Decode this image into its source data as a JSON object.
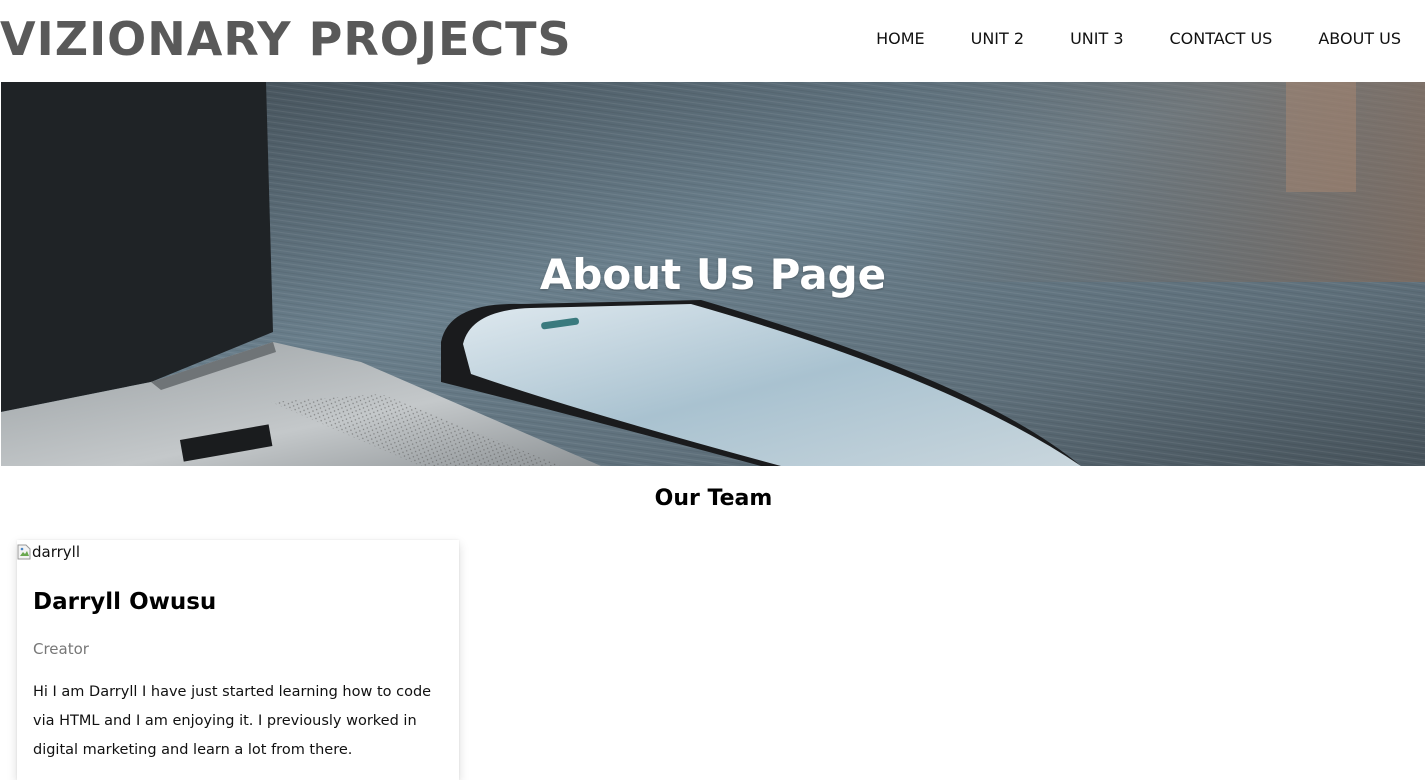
{
  "header": {
    "logo": "VIZIONARY PROJECTS",
    "nav": [
      {
        "label": "HOME"
      },
      {
        "label": "UNIT 2"
      },
      {
        "label": "UNIT 3"
      },
      {
        "label": "CONTACT US"
      },
      {
        "label": "ABOUT US"
      }
    ]
  },
  "hero": {
    "title": "About Us Page"
  },
  "team": {
    "heading": "Our Team",
    "members": [
      {
        "image_alt": "darryll",
        "name": "Darryll Owusu",
        "role": "Creator",
        "bio": "Hi I am Darryll I have just started learning how to code via HTML and I am enjoying it. I previously worked in digital marketing and learn a lot from there."
      }
    ]
  },
  "colors": {
    "logo": "#595959",
    "nav_text": "#111111",
    "hero_title": "#ffffff",
    "role_text": "#777777"
  }
}
